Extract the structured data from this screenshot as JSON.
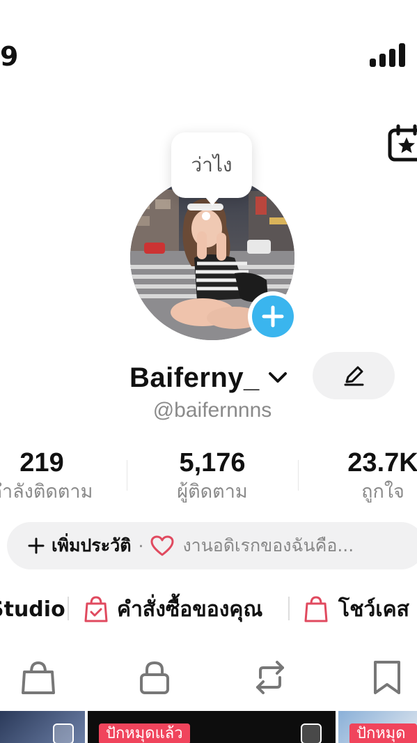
{
  "status_bar": {
    "time": "9"
  },
  "note_bubble": {
    "text": "ว่าไง"
  },
  "profile": {
    "display_name": "Baiferny_",
    "username": "@baifernnns"
  },
  "stats": [
    {
      "value": "219",
      "label": "กำลังติดตาม"
    },
    {
      "value": "5,176",
      "label": "ผู้ติดตาม"
    },
    {
      "value": "23.7K",
      "label": "ถูกใจ"
    }
  ],
  "bio": {
    "add_label": "เพิ่มประวัติ",
    "separator": "·",
    "preview_text": "งานอดิเรกของฉันคือ..."
  },
  "links": {
    "studio_label": "Studio",
    "orders_label": "คำสั่งซื้อของคุณ",
    "showcase_label": "โชว์เคส"
  },
  "tabs": [
    "shop-bag-icon",
    "lock-icon",
    "repost-icon",
    "bookmark-icon"
  ],
  "grid": {
    "pinned_label": "ปักหมุดแล้ว"
  },
  "colors": {
    "accent_blue": "#3ab5ee",
    "shop_red": "#e04a5f",
    "pinned_red": "#f0445c"
  }
}
